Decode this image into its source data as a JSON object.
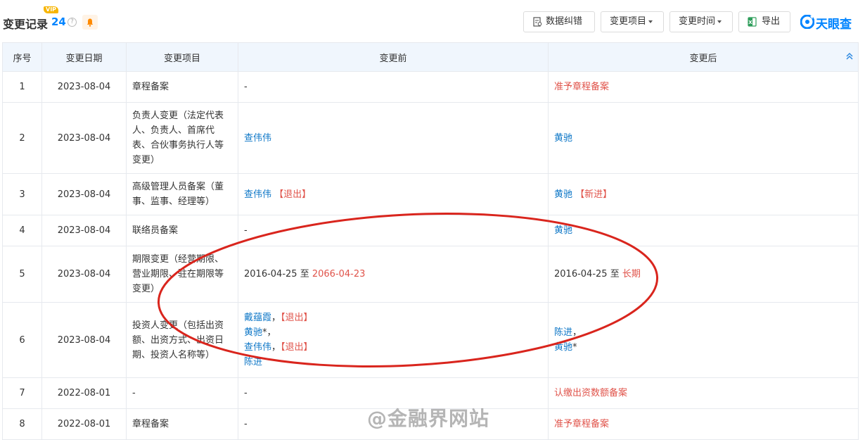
{
  "header": {
    "title": "变更记录",
    "count": "24",
    "vip_badge": "VIP",
    "help_glyph": "?"
  },
  "toolbar": {
    "data_correction": "数据纠错",
    "change_item": "变更项目",
    "change_time": "变更时间",
    "export": "导出"
  },
  "brand": {
    "name": "天眼查"
  },
  "table": {
    "headers": [
      "序号",
      "变更日期",
      "变更项目",
      "变更前",
      "变更后"
    ],
    "rows": [
      {
        "idx": "1",
        "date": "2023-08-04",
        "item": "章程备案",
        "before": "-",
        "after": "准予章程备案"
      },
      {
        "idx": "2",
        "date": "2023-08-04",
        "item": "负责人变更（法定代表人、负责人、首席代表、合伙事务执行人等变更）",
        "before": "查伟伟",
        "after": "黄驰"
      },
      {
        "idx": "3",
        "date": "2023-08-04",
        "item": "高级管理人员备案（董事、监事、经理等）",
        "before_name": "查伟伟",
        "before_tag": "【退出】",
        "after_name": "黄驰",
        "after_tag": "【新进】"
      },
      {
        "idx": "4",
        "date": "2023-08-04",
        "item": "联络员备案",
        "before": "-",
        "after": "黄驰"
      },
      {
        "idx": "5",
        "date": "2023-08-04",
        "item": "期限变更（经营期限、营业期限、驻在期限等变更）",
        "before_from": "2016-04-25",
        "before_sep": "至",
        "before_to": "2066-04-23",
        "after_from": "2016-04-25",
        "after_sep": "至",
        "after_to": "长期"
      },
      {
        "idx": "6",
        "date": "2023-08-04",
        "item": "投资人变更（包括出资额、出资方式、出资日期、投资人名称等）",
        "before_lines": [
          {
            "name": "戴蕴霞",
            "suffix": "，",
            "tag": "【退出】"
          },
          {
            "name": "黄驰",
            "suffix": "*，",
            "tag": ""
          },
          {
            "name": "查伟伟",
            "suffix": "，",
            "tag": "【退出】"
          },
          {
            "name": "陈进",
            "suffix": "",
            "tag": ""
          }
        ],
        "after_lines": [
          {
            "name": "陈进",
            "suffix": "，"
          },
          {
            "name": "黄驰",
            "suffix": "*"
          }
        ]
      },
      {
        "idx": "7",
        "date": "2022-08-01",
        "item": "-",
        "before": "-",
        "after": "认缴出资数额备案"
      },
      {
        "idx": "8",
        "date": "2022-08-01",
        "item": "章程备案",
        "before": "-",
        "after": "准予章程备案"
      }
    ]
  },
  "watermark": "@金融界网站",
  "colors": {
    "link": "#0e77c7",
    "accent_red": "#e0534a",
    "brand_blue": "#0084ff",
    "header_bg": "#f0f6fd",
    "annotation_red": "#d9251d"
  }
}
